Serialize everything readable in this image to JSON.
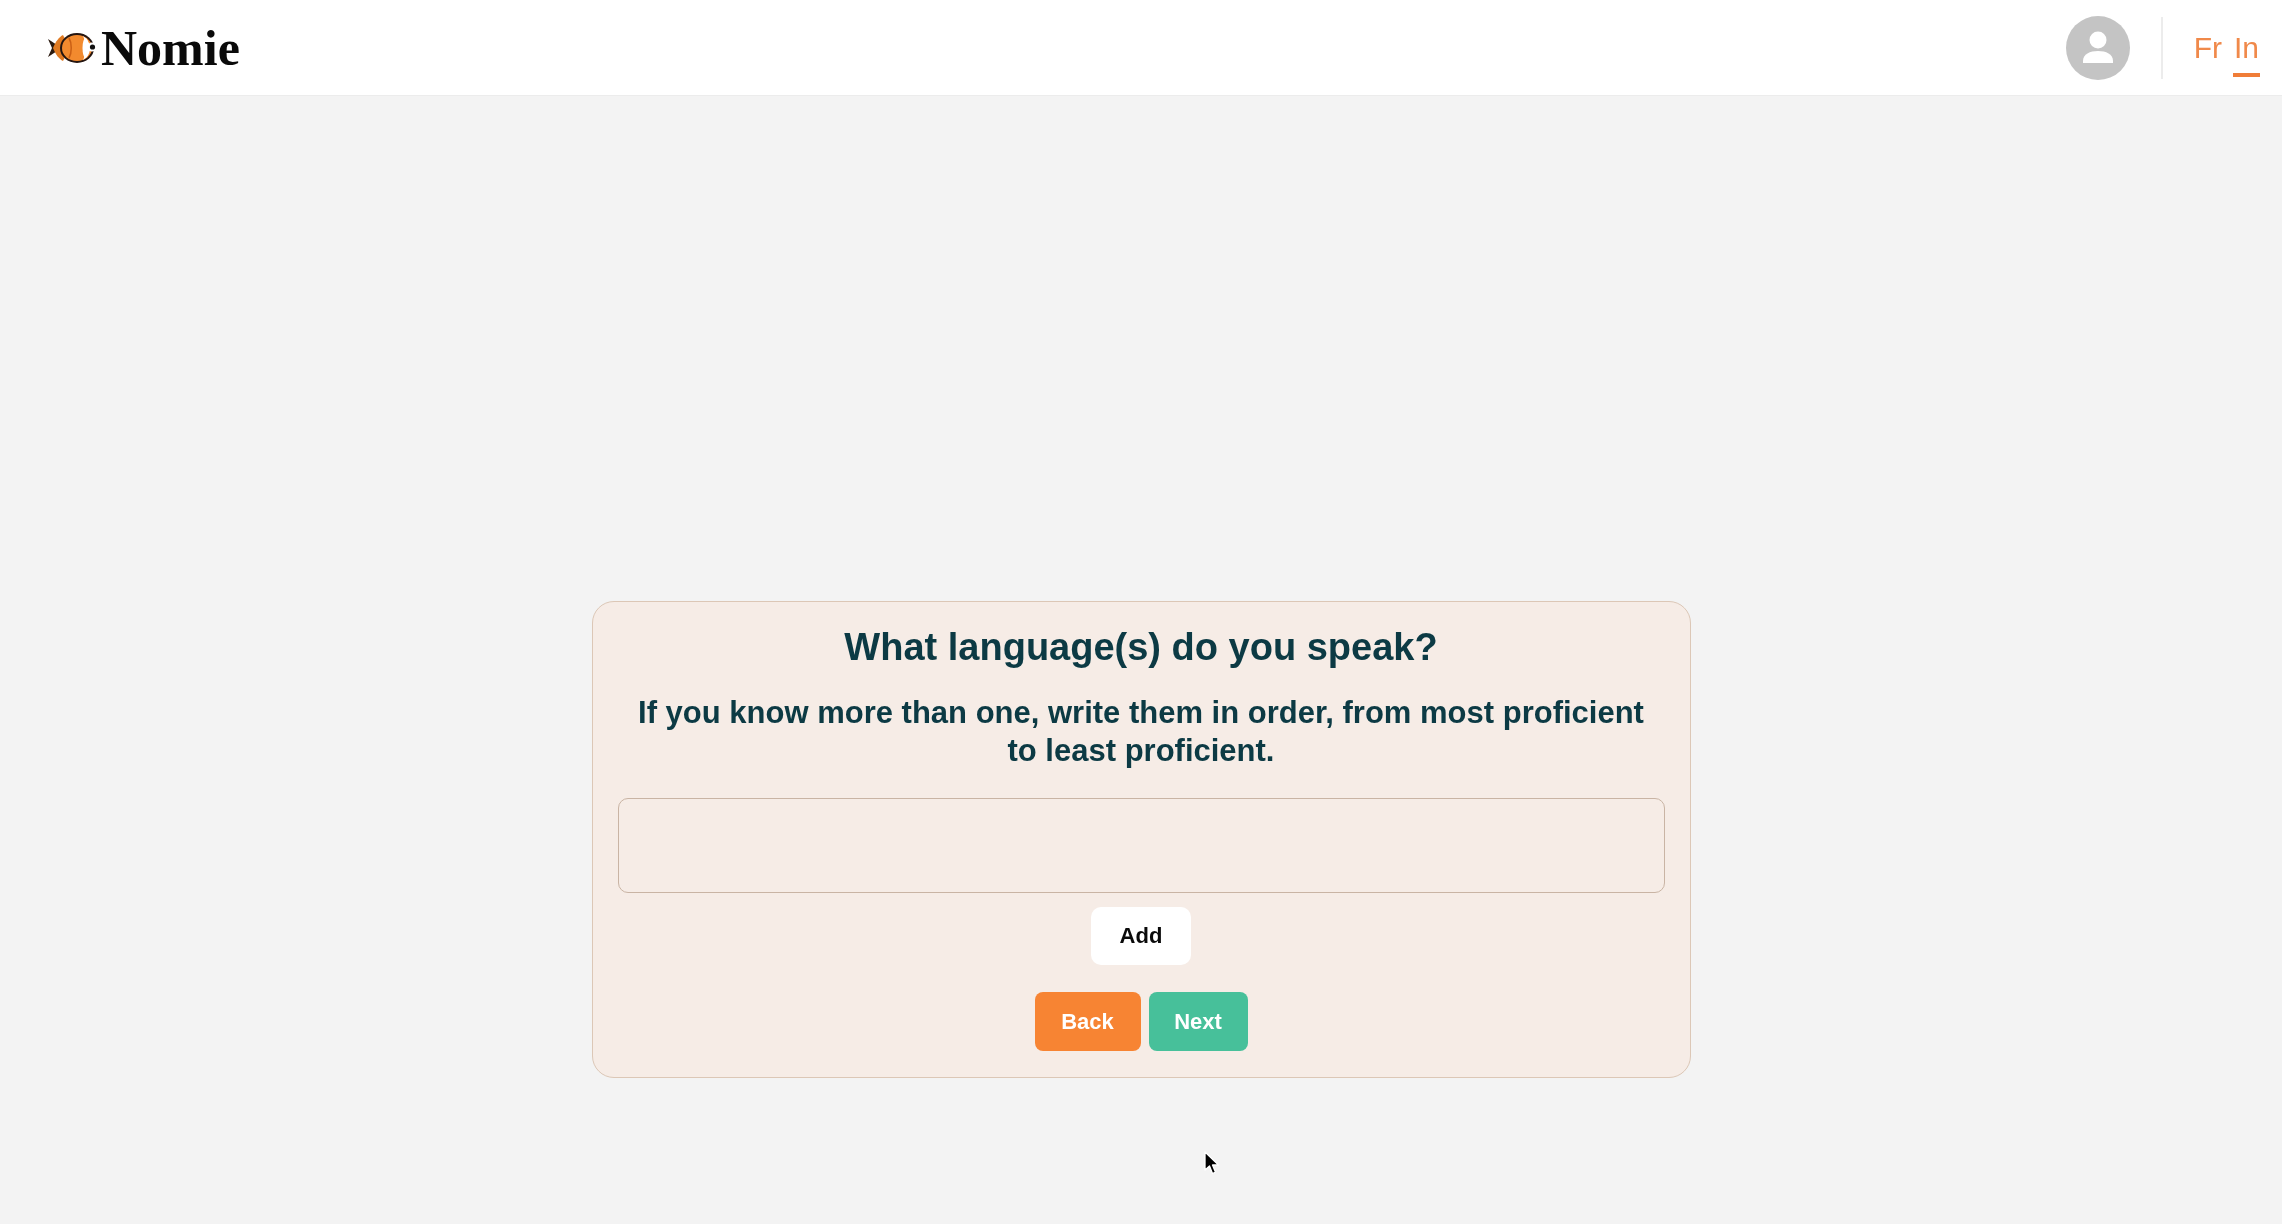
{
  "header": {
    "logo": "Nomie",
    "languages": [
      {
        "label": "Fr",
        "selected": false
      },
      {
        "label": "In",
        "selected": true
      }
    ]
  },
  "question": {
    "title": "What language(s) do you speak?",
    "hint": "If you know more than one, write them in order, from most proficient to least proficient.",
    "add_button": "Add",
    "nav_buttons": [
      {
        "label": "Back",
        "kind": "back"
      },
      {
        "label": "Next",
        "kind": "next"
      }
    ]
  }
}
